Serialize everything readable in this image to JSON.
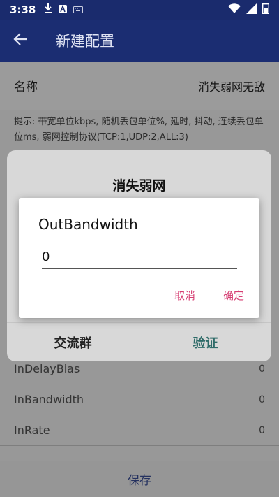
{
  "status_bar": {
    "time": "3:38",
    "icons_left": [
      "download-icon",
      "app-a-icon",
      "keyboard-icon"
    ],
    "icons_right": [
      "wifi-icon",
      "signal-icon",
      "battery-icon"
    ]
  },
  "app_bar": {
    "title": "新建配置"
  },
  "form": {
    "name_label": "名称",
    "name_value": "消失弱网无敌",
    "hint": "提示: 带宽单位kbps, 随机丢包单位%, 延时, 抖动, 连续丢包单位ms, 弱网控制协议(TCP:1,UDP:2,ALL:3)"
  },
  "params": [
    {
      "label": "InDelayBias",
      "value": "0"
    },
    {
      "label": "InBandwidth",
      "value": "0"
    },
    {
      "label": "InRate",
      "value": "0"
    }
  ],
  "save_label": "保存",
  "back_dialog": {
    "title": "消失弱网",
    "left_button": "交流群",
    "right_button": "验证"
  },
  "input_dialog": {
    "title": "OutBandwidth",
    "value": "0",
    "cancel": "取消",
    "confirm": "确定"
  },
  "colors": {
    "primary": "#1b2d72",
    "accent": "#d63d72",
    "verify": "#2e6b68"
  }
}
